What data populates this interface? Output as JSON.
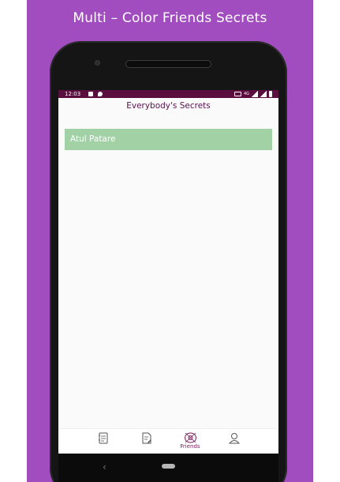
{
  "banner": {
    "title": "Multi – Color Friends Secrets"
  },
  "status_bar": {
    "time": "12:03",
    "network": "4G"
  },
  "app": {
    "title": "Everybody's Secrets"
  },
  "friends": [
    {
      "name": "Atul Patare",
      "color": "#a3d1a6"
    }
  ],
  "bottom_nav": {
    "items": [
      {
        "icon": "notebook-icon",
        "label": ""
      },
      {
        "icon": "note-edit-icon",
        "label": ""
      },
      {
        "icon": "friends-icon",
        "label": "Friends",
        "active": true
      },
      {
        "icon": "person-icon",
        "label": ""
      }
    ]
  },
  "colors": {
    "background": "#a24dbf",
    "status_bar": "#5a0f3e",
    "title": "#5a1050",
    "friend_item": "#a3d1a6",
    "active_nav": "#7a1c5e"
  }
}
